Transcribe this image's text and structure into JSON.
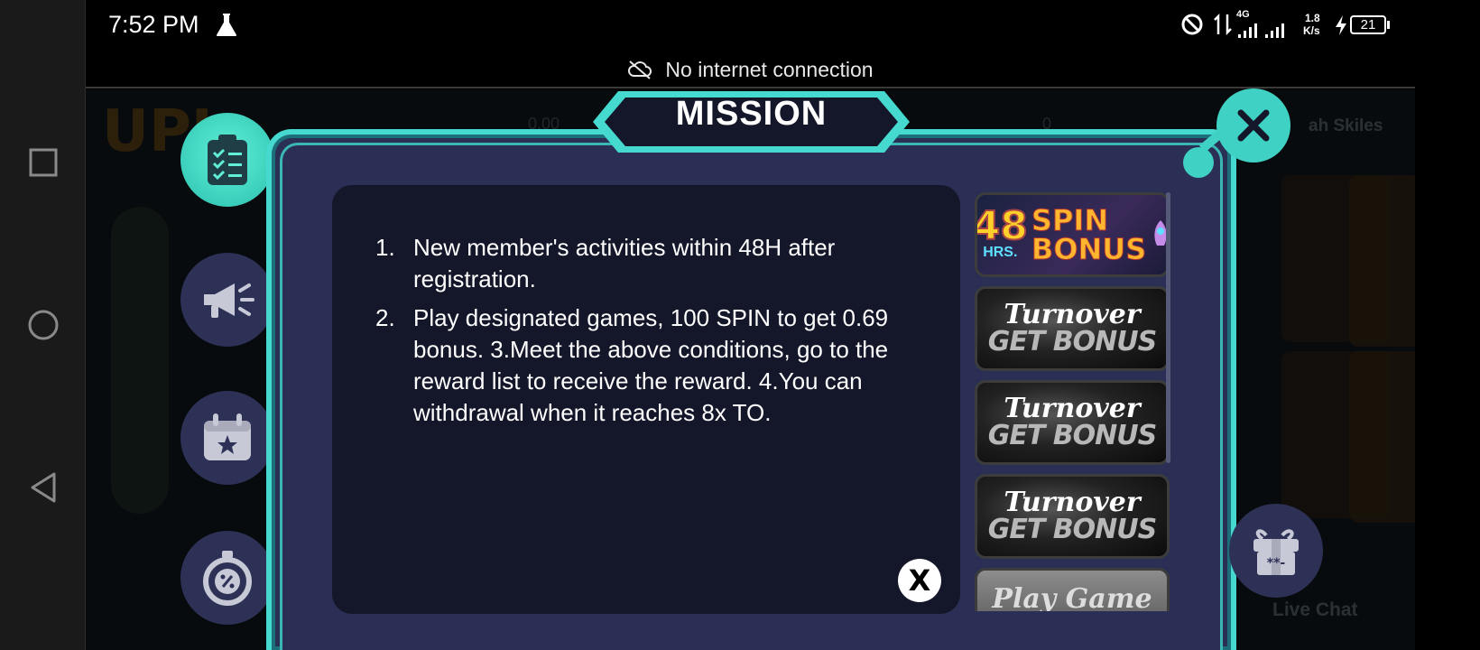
{
  "status_bar": {
    "time": "7:52 PM",
    "network_type": "4G",
    "speed_value": "1.8",
    "speed_unit": "K/s",
    "battery": "21"
  },
  "banner": {
    "text": "No internet connection"
  },
  "background": {
    "logo": "UPL",
    "user_name": "ah Skiles",
    "live_chat": "Live Chat",
    "stat_1": "0.00",
    "stat_2": "0"
  },
  "side_menu": [
    {
      "name": "mission",
      "icon": "clipboard-checklist-icon",
      "active": true
    },
    {
      "name": "announcement",
      "icon": "megaphone-icon",
      "active": false
    },
    {
      "name": "event",
      "icon": "calendar-star-icon",
      "active": false
    },
    {
      "name": "timer",
      "icon": "stopwatch-icon",
      "active": false
    }
  ],
  "dialog": {
    "title": "MISSION",
    "items": [
      {
        "num": "1.",
        "text": "New member's activities within 48H after registration."
      },
      {
        "num": "2.",
        "text": "Play designated games, 100 SPIN to get 0.69 bonus. 3.Meet the above conditions, go to the reward list to receive the reward. 4.You can withdrawal when it reaches 8x TO."
      }
    ],
    "close_small": "X"
  },
  "missions": [
    {
      "type": "spin",
      "big": "48",
      "small": "HRS.",
      "line1": "SPIN",
      "line2": "BONUS"
    },
    {
      "type": "turnover",
      "line1": "Turnover",
      "line2": "GET BONUS"
    },
    {
      "type": "turnover",
      "line1": "Turnover",
      "line2": "GET BONUS"
    },
    {
      "type": "turnover",
      "line1": "Turnover",
      "line2": "GET BONUS"
    },
    {
      "type": "play",
      "line1": "Play Game"
    }
  ],
  "colors": {
    "accent_teal": "#45d9cf",
    "panel": "#2a2f54",
    "desc_bg": "#141629"
  }
}
